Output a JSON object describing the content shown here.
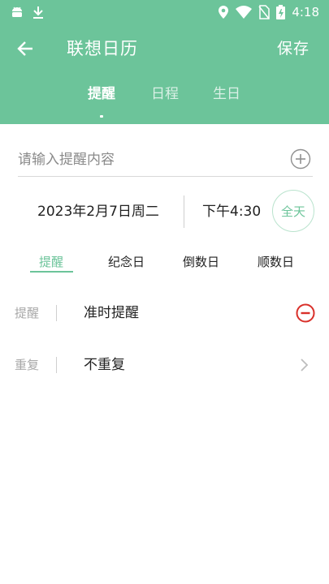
{
  "status_bar": {
    "time": "4:18",
    "left_icons": [
      "android-icon",
      "download-icon"
    ],
    "right_icons": [
      "location-icon",
      "wifi-icon",
      "no-sim-icon",
      "battery-icon"
    ]
  },
  "app_bar": {
    "title": "联想日历",
    "save_label": "保存",
    "back_icon": "arrow-left-icon"
  },
  "top_tabs": [
    {
      "label": "提醒",
      "active": true
    },
    {
      "label": "日程",
      "active": false
    },
    {
      "label": "生日",
      "active": false
    }
  ],
  "content_input": {
    "placeholder": "请输入提醒内容",
    "value": "",
    "add_icon": "plus-circle-icon"
  },
  "datetime": {
    "date": "2023年2月7日周二",
    "time": "下午4:30",
    "all_day_label": "全天"
  },
  "type_tabs": [
    {
      "label": "提醒",
      "active": true
    },
    {
      "label": "纪念日",
      "active": false
    },
    {
      "label": "倒数日",
      "active": false
    },
    {
      "label": "顺数日",
      "active": false
    }
  ],
  "fields": {
    "reminder": {
      "label": "提醒",
      "value": "准时提醒",
      "action_icon": "minus-circle-icon"
    },
    "repeat": {
      "label": "重复",
      "value": "不重复",
      "action_icon": "chevron-right-icon"
    }
  },
  "colors": {
    "accent": "#6cc49a",
    "danger": "#d9302a",
    "label_gray": "#a8a8a8"
  }
}
